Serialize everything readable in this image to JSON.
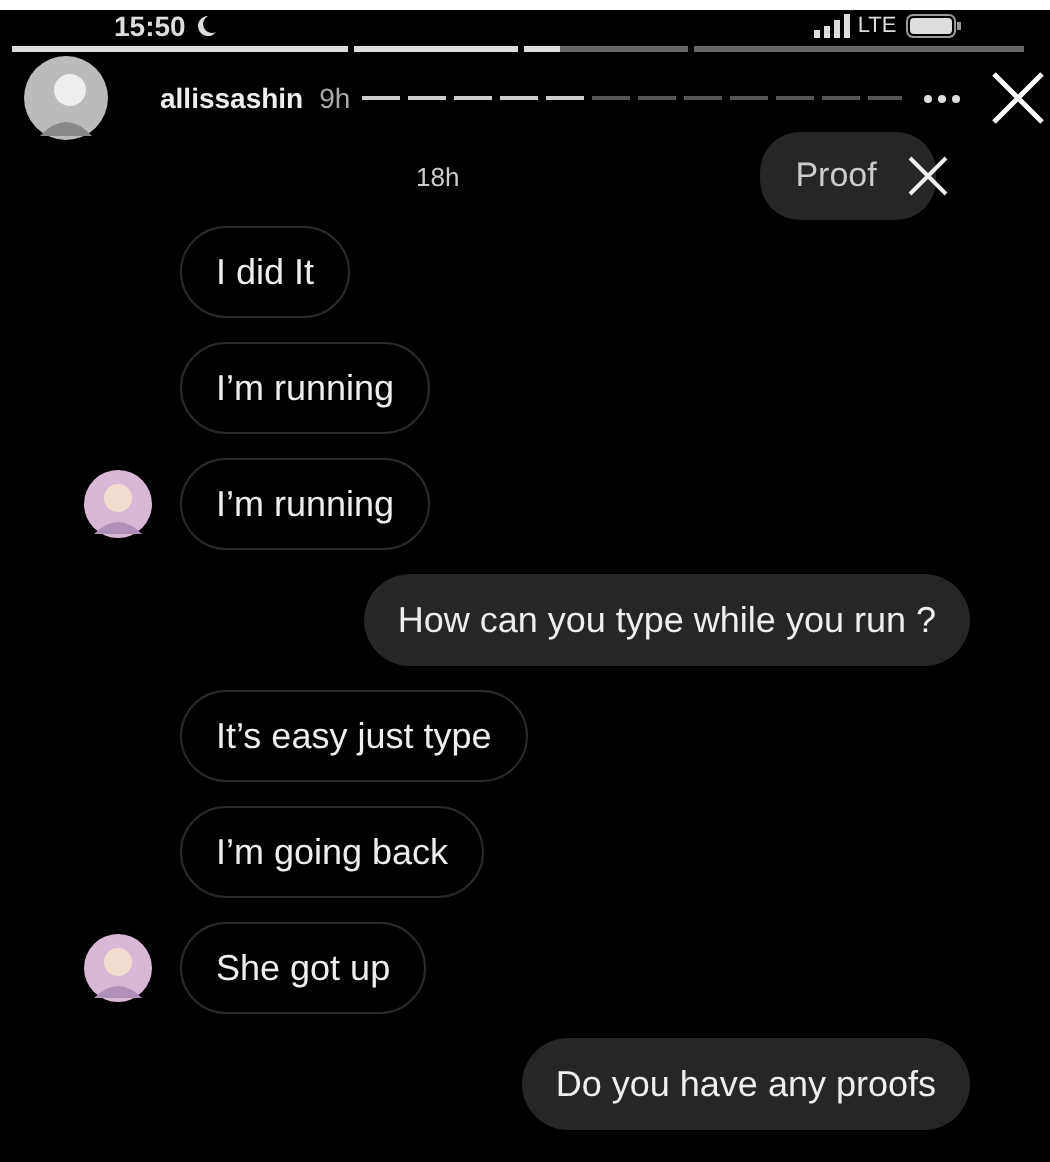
{
  "status_bar": {
    "time": "15:50",
    "network": "LTE"
  },
  "story": {
    "user": "allissashin",
    "age": "9h"
  },
  "chat": {
    "timestamp": "18h",
    "top_bubble": "Proof",
    "messages": [
      {
        "text": "I did It",
        "kind": "incoming",
        "avatar": false
      },
      {
        "text": "I’m running",
        "kind": "incoming",
        "avatar": false
      },
      {
        "text": "I’m running",
        "kind": "incoming",
        "avatar": true
      },
      {
        "text": "How can you type while you run ?",
        "kind": "outgoing",
        "avatar": false
      },
      {
        "text": "It’s easy just type",
        "kind": "incoming",
        "avatar": false
      },
      {
        "text": "I’m going back",
        "kind": "incoming",
        "avatar": false
      },
      {
        "text": "She got up",
        "kind": "incoming",
        "avatar": true
      },
      {
        "text": "Do you have any proofs",
        "kind": "outgoing",
        "avatar": false
      }
    ]
  }
}
